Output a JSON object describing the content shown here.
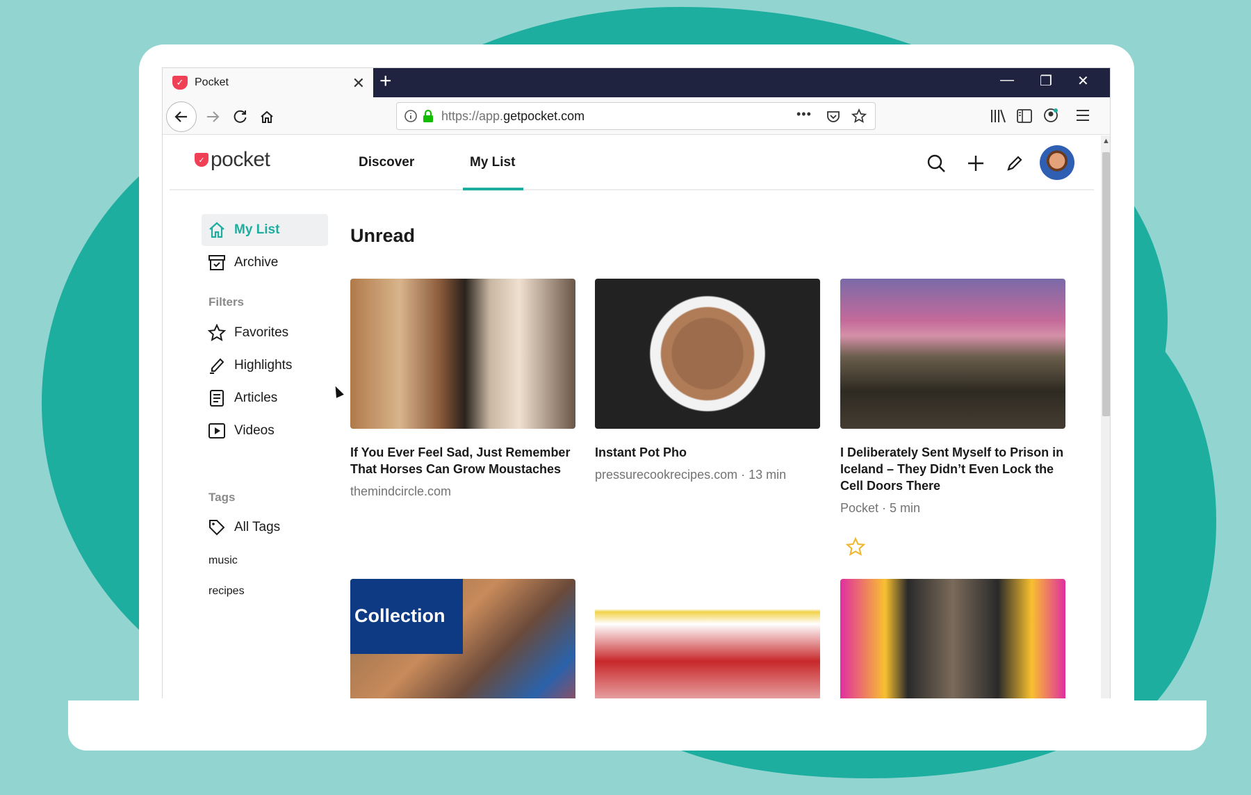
{
  "browser": {
    "tab_title": "Pocket",
    "tab_close": "✕",
    "new_tab": "+",
    "window_controls": {
      "minimize": "—",
      "restore": "❐",
      "close": "✕"
    },
    "url_prefix": "https://app.",
    "url_host": "getpocket.com",
    "url_more": "•••"
  },
  "header": {
    "logo_text": "pocket",
    "nav": [
      {
        "label": "Discover",
        "active": false
      },
      {
        "label": "My List",
        "active": true
      }
    ]
  },
  "sidebar": {
    "items": [
      {
        "label": "My List",
        "icon": "home-icon",
        "active": true
      },
      {
        "label": "Archive",
        "icon": "archive-icon",
        "active": false
      }
    ],
    "filters_heading": "Filters",
    "filters": [
      {
        "label": "Favorites",
        "icon": "star-icon"
      },
      {
        "label": "Highlights",
        "icon": "highlighter-icon"
      },
      {
        "label": "Articles",
        "icon": "article-icon"
      },
      {
        "label": "Videos",
        "icon": "video-icon"
      }
    ],
    "tags_heading": "Tags",
    "all_tags": "All Tags",
    "tags": [
      "music",
      "recipes"
    ]
  },
  "main": {
    "section_title": "Unread",
    "cards": [
      {
        "title": "If You Ever Feel Sad, Just Remember That Horses Can Grow Moustaches",
        "meta": "themindcircle.com",
        "favorite": false
      },
      {
        "title": "Instant Pot Pho",
        "meta": "pressurecookrecipes.com · 13 min",
        "favorite": false
      },
      {
        "title": "I Deliberately Sent Myself to Prison in Iceland – They Didn’t Even Lock the Cell Doors There",
        "meta": "Pocket · 5 min",
        "favorite": true
      }
    ],
    "row2": [
      {
        "overlay": "Collection"
      },
      {
        "overlay": ""
      },
      {
        "overlay": ""
      }
    ]
  },
  "colors": {
    "accent": "#1eaea0",
    "brand_red": "#ef4056",
    "star": "#f0b72f"
  }
}
